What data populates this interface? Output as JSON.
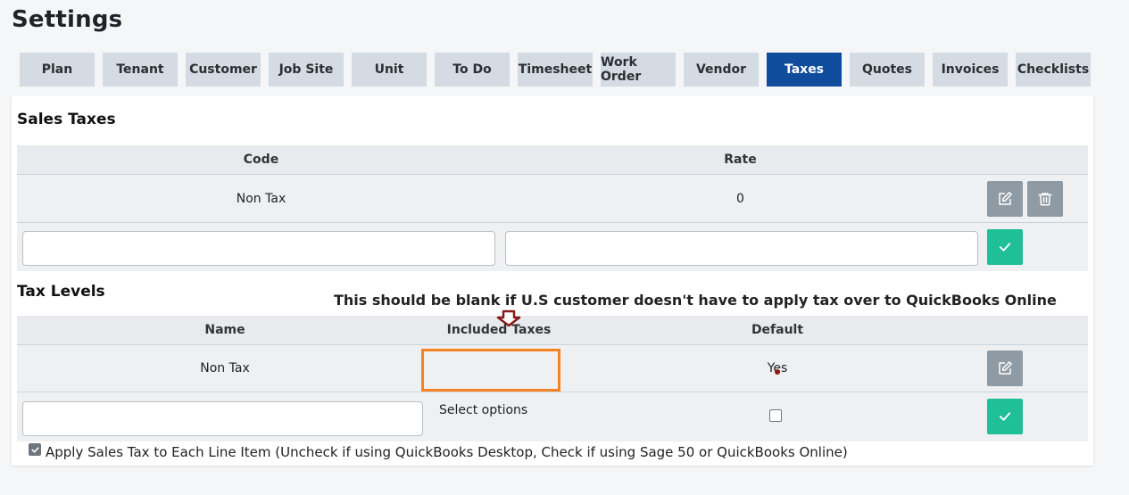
{
  "page": {
    "title": "Settings"
  },
  "tabs": [
    {
      "label": "Plan",
      "active": false
    },
    {
      "label": "Tenant",
      "active": false
    },
    {
      "label": "Customer",
      "active": false
    },
    {
      "label": "Job Site",
      "active": false
    },
    {
      "label": "Unit",
      "active": false
    },
    {
      "label": "To Do",
      "active": false
    },
    {
      "label": "Timesheet",
      "active": false
    },
    {
      "label": "Work Order",
      "active": false
    },
    {
      "label": "Vendor",
      "active": false
    },
    {
      "label": "Taxes",
      "active": true
    },
    {
      "label": "Quotes",
      "active": false
    },
    {
      "label": "Invoices",
      "active": false
    },
    {
      "label": "Checklists",
      "active": false
    }
  ],
  "sales_taxes": {
    "title": "Sales Taxes",
    "columns": {
      "code": "Code",
      "rate": "Rate"
    },
    "rows": [
      {
        "code": "Non Tax",
        "rate": "0"
      }
    ],
    "new_row": {
      "code_value": "",
      "rate_value": ""
    }
  },
  "tax_levels": {
    "title": "Tax Levels",
    "columns": {
      "name": "Name",
      "included_taxes": "Included Taxes",
      "default": "Default"
    },
    "rows": [
      {
        "name": "Non Tax",
        "included_taxes": "",
        "default": "Yes"
      }
    ],
    "new_row": {
      "name_value": "",
      "included_placeholder": "Select options",
      "default_checked": false
    }
  },
  "apply_sales_tax": {
    "checked": true,
    "label": "Apply Sales Tax to Each Line Item (Uncheck if using QuickBooks Desktop, Check if using Sage 50 or QuickBooks Online)"
  },
  "annotation": {
    "text": "This should be blank if U.S customer doesn't have to apply tax over to QuickBooks Online"
  },
  "colors": {
    "active_tab": "#0f4c9b",
    "tab": "#d4dbe2",
    "gray_button": "#8e9aa4",
    "green_button": "#1fbf98",
    "annotation_box": "#f58220",
    "annotation_arrow": "#8b1a1a"
  },
  "icons": {
    "edit": "edit-icon",
    "delete": "trash-icon",
    "save": "check-icon"
  }
}
